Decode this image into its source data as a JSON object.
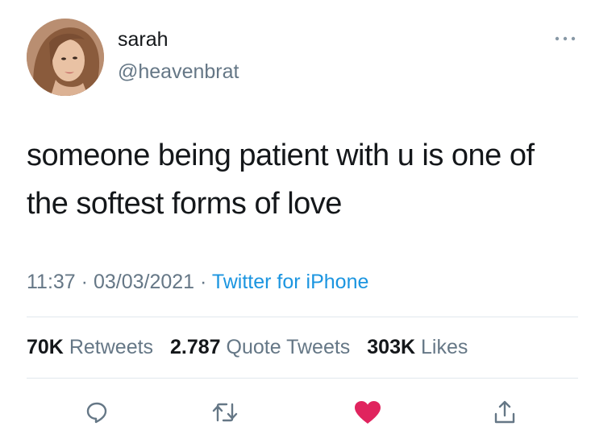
{
  "user": {
    "name": "sarah",
    "handle": "@heavenbrat"
  },
  "tweet": {
    "text": "someone being patient with u is one of the softest forms of love",
    "time": "11:37",
    "date": "03/03/2021",
    "separator": "·",
    "source": "Twitter for iPhone"
  },
  "stats": {
    "retweets_count": "70K",
    "retweets_label": "Retweets",
    "quotes_count": "2.787",
    "quotes_label": "Quote Tweets",
    "likes_count": "303K",
    "likes_label": "Likes"
  },
  "colors": {
    "text": "#14171a",
    "muted": "#657786",
    "link": "#1b95e0",
    "like": "#e0245e",
    "divider": "#e1e8ed"
  },
  "icons": {
    "more": "more-icon",
    "reply": "reply-icon",
    "retweet": "retweet-icon",
    "like": "heart-icon",
    "share": "share-icon"
  }
}
